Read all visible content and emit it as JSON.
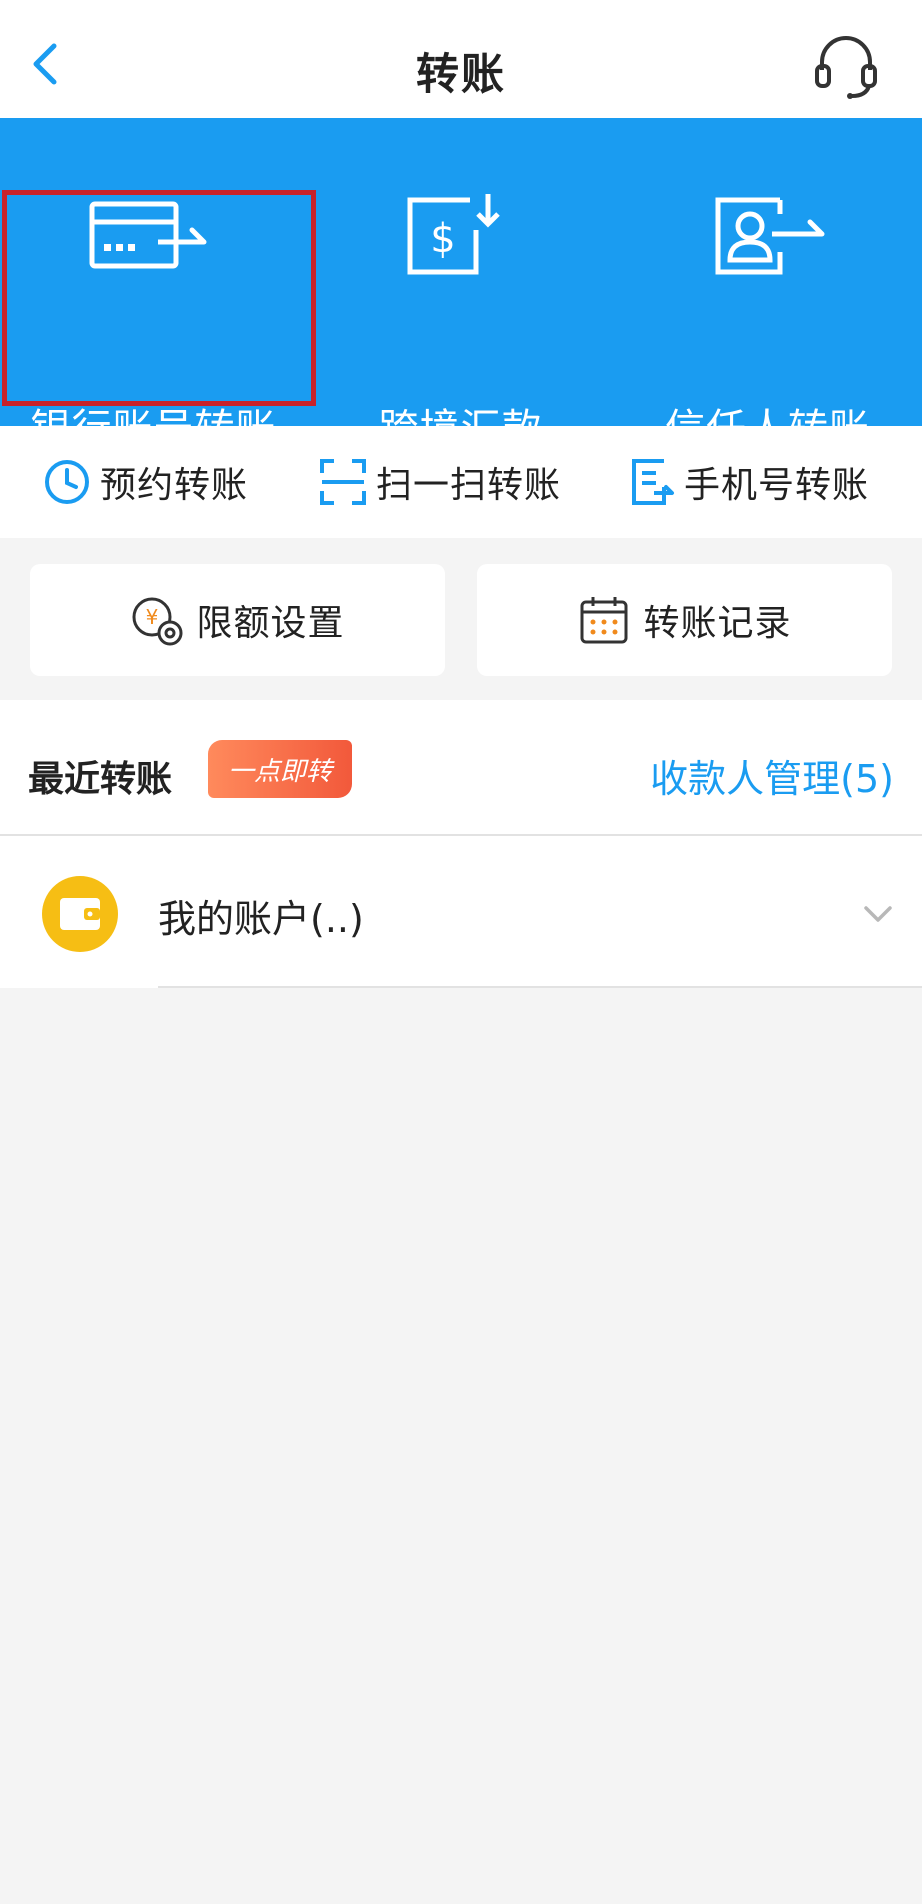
{
  "nav": {
    "title": "转账",
    "back_icon": "chevron-left-icon",
    "service_icon": "headset-icon"
  },
  "colors": {
    "primary": "#1a9cf1",
    "highlight": "#c8222a",
    "badge": "#f2593b",
    "wallet": "#f6be14"
  },
  "main_functions": [
    {
      "label": "银行账号转账",
      "icon": "bank-card-transfer-icon",
      "highlighted": true
    },
    {
      "label": "跨境汇款",
      "icon": "dollar-document-icon"
    },
    {
      "label": "信任人转账",
      "icon": "person-transfer-icon"
    }
  ],
  "quick_functions": [
    {
      "label": "预约转账",
      "icon": "clock-icon"
    },
    {
      "label": "扫一扫转账",
      "icon": "scan-icon"
    },
    {
      "label": "手机号转账",
      "icon": "phone-document-icon"
    }
  ],
  "cards": [
    {
      "label": "限额设置",
      "icon": "yuan-settings-icon"
    },
    {
      "label": "转账记录",
      "icon": "calendar-icon"
    }
  ],
  "recent": {
    "title": "最近转账",
    "badge": "一点即转",
    "payee_link": "收款人管理(5)"
  },
  "account": {
    "label": "我的账户(..)",
    "icon": "wallet-icon"
  }
}
